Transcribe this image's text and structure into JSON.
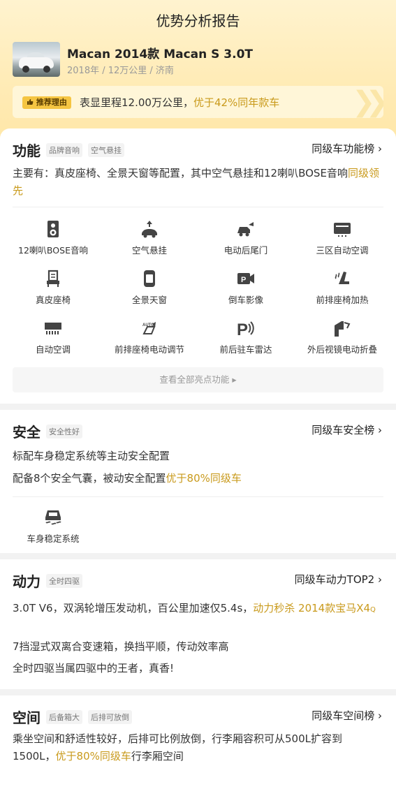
{
  "page_title": "优势分析报告",
  "car": {
    "name": "Macan 2014款 Macan S 3.0T",
    "meta": "2018年 / 12万公里 / 济南"
  },
  "reason": {
    "tag": "推荐理由",
    "text": "表显里程12.00万公里，",
    "highlight": "优于42%同年款车"
  },
  "function": {
    "title": "功能",
    "tags": [
      "品牌音响",
      "空气悬挂"
    ],
    "rank_link": "同级车功能榜 ›",
    "desc": "主要有：真皮座椅、全景天窗等配置，其中空气悬挂和12喇叭BOSE音响",
    "desc_hl": "同级领先",
    "features": [
      {
        "label": "12喇叭BOSE音响",
        "icon": "speaker-icon"
      },
      {
        "label": "空气悬挂",
        "icon": "air-suspension-icon"
      },
      {
        "label": "电动后尾门",
        "icon": "power-tailgate-icon"
      },
      {
        "label": "三区自动空调",
        "icon": "tri-zone-ac-icon"
      },
      {
        "label": "真皮座椅",
        "icon": "leather-seat-icon"
      },
      {
        "label": "全景天窗",
        "icon": "panoramic-sunroof-icon"
      },
      {
        "label": "倒车影像",
        "icon": "reverse-camera-icon"
      },
      {
        "label": "前排座椅加热",
        "icon": "seat-heating-icon"
      },
      {
        "label": "自动空调",
        "icon": "auto-ac-icon"
      },
      {
        "label": "前排座椅电动调节",
        "icon": "power-seat-icon"
      },
      {
        "label": "前后驻车雷达",
        "icon": "parking-radar-icon"
      },
      {
        "label": "外后视镜电动折叠",
        "icon": "mirror-fold-icon"
      }
    ],
    "see_all": "查看全部亮点功能 ▸"
  },
  "safety": {
    "title": "安全",
    "tag": "安全性好",
    "rank_link": "同级车安全榜 ›",
    "line1": "标配车身稳定系统等主动安全配置",
    "line2": "配备8个安全气囊，被动安全配置",
    "line2_hl": "优于80%同级车",
    "feature_label": "车身稳定系统"
  },
  "power": {
    "title": "动力",
    "tag": "全时四驱",
    "rank_link": "同级车动力TOP2 ›",
    "line1": "3.0T V6，双涡轮增压发动机，百公里加速仅5.4s，",
    "line1_hl": "动力秒杀 2014款宝马X4",
    "line1_q": "Q",
    "line2": "7挡湿式双离合变速箱，换挡平顺，传动效率高",
    "line3": "全时四驱当属四驱中的王者，真香!"
  },
  "space": {
    "title": "空间",
    "tags": [
      "后备箱大",
      "后排可放倒"
    ],
    "rank_link": "同级车空间榜 ›",
    "line1": "乘坐空间和舒适性较好，后排可比例放倒，行李厢容积可从500L扩容到1500L，",
    "line1_hl": "优于80%同级车",
    "line1_tail": "行李厢空间"
  },
  "colors": {
    "accent": "#c99a1c",
    "tag_bg": "#f5c542",
    "header_bg": "#ffecb8",
    "icon": "#444444"
  }
}
